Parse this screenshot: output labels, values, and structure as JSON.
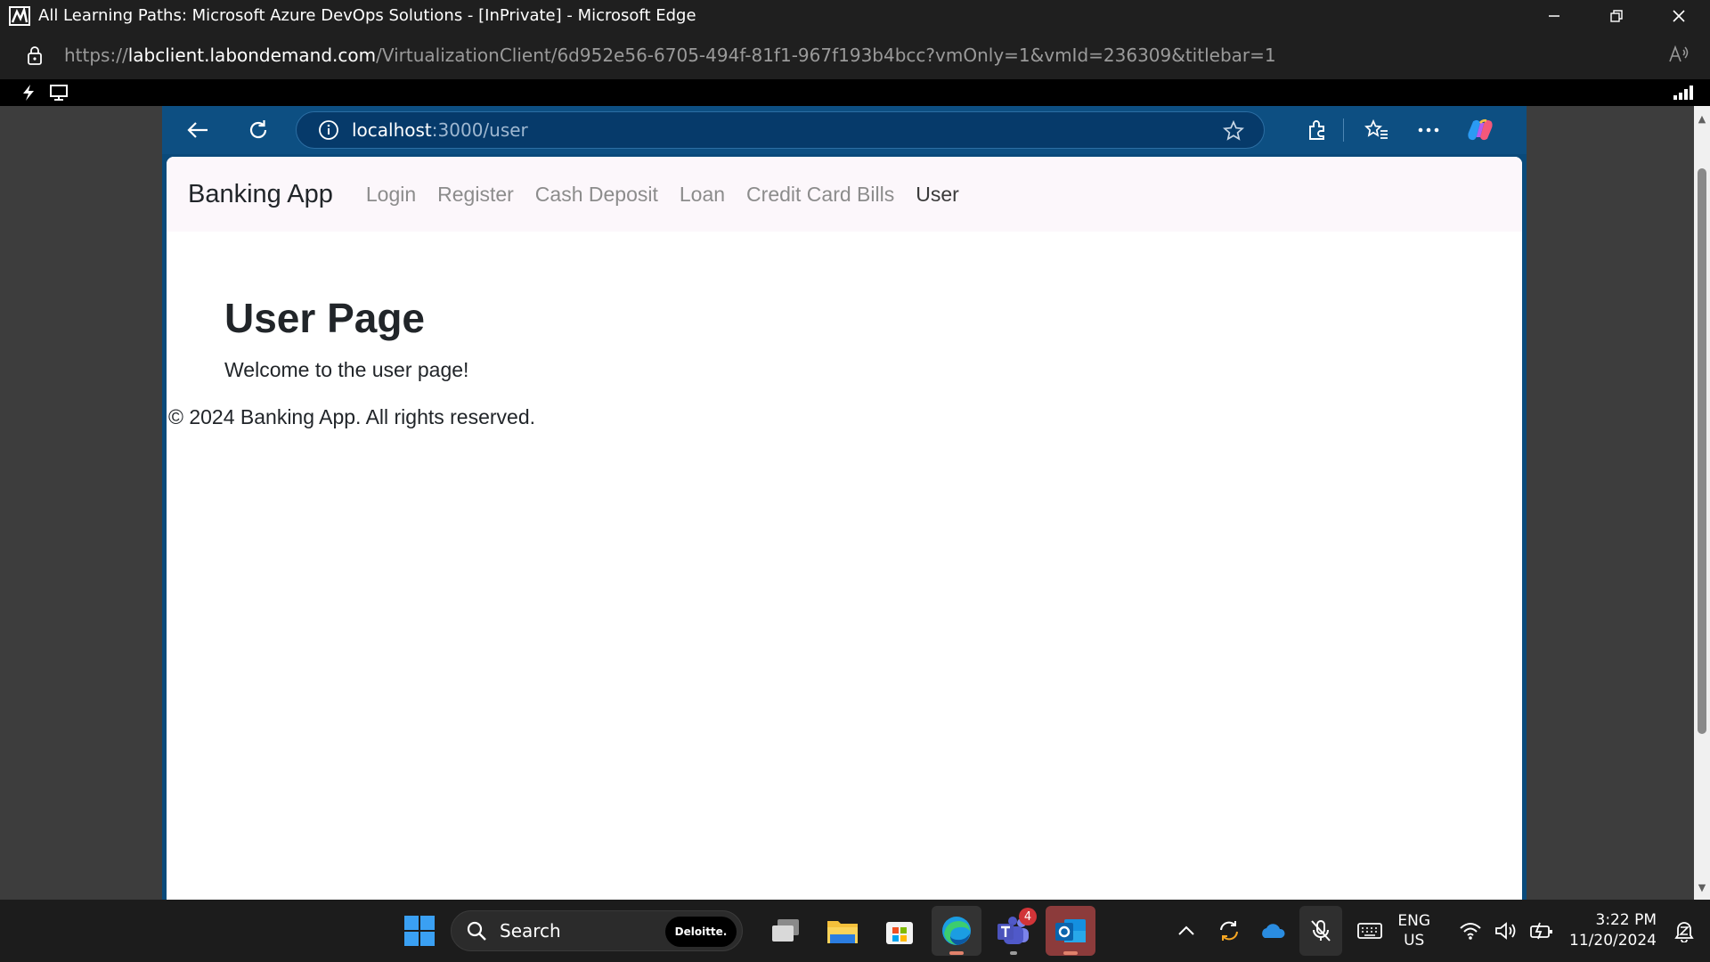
{
  "window": {
    "title": "All Learning Paths: Microsoft Azure DevOps Solutions - [InPrivate] - Microsoft Edge",
    "url_prefix": "https://",
    "url_host": "labclient.labondemand.com",
    "url_path": "/VirtualizationClient/6d952e56-6705-494f-81f1-967f193b4bcc?vmOnly=1&vmId=236309&titlebar=1"
  },
  "inner_browser": {
    "url_host": "localhost",
    "url_path": ":3000/user"
  },
  "navbar": {
    "brand": "Banking App",
    "links": [
      "Login",
      "Register",
      "Cash Deposit",
      "Loan",
      "Credit Card Bills",
      "User"
    ]
  },
  "content": {
    "heading": "User Page",
    "text": "Welcome to the user page!",
    "footer": "© 2024 Banking App. All rights reserved."
  },
  "taskbar": {
    "search_label": "Search",
    "search_badge": "Deloitte.",
    "teams_badge": "4",
    "lang_line1": "ENG",
    "lang_line2": "US",
    "time": "3:22 PM",
    "date": "11/20/2024"
  },
  "colors": {
    "inner_toolbar": "#0d4f82",
    "navbar_bg": "#fcf7fb",
    "taskbar": "#1c1c1c"
  }
}
